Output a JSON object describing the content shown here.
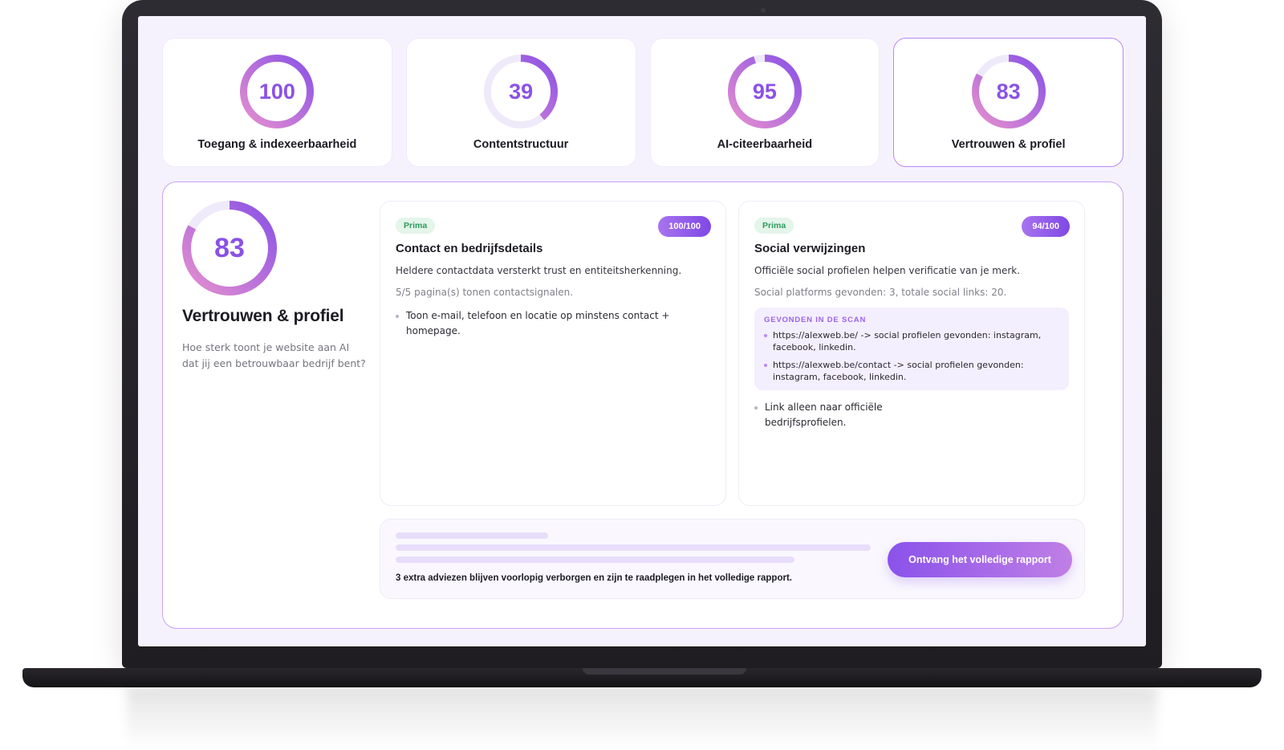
{
  "colors": {
    "accent": "#8a52e6",
    "ring_start": "#e58fcf",
    "ring_end": "#8a52e6",
    "ring_track": "#efeafa",
    "success": "#2c9b5a"
  },
  "score_cards": [
    {
      "score": 100,
      "label": "Toegang & indexeerbaarheid",
      "progress": 1.0,
      "active": false
    },
    {
      "score": 39,
      "label": "Contentstructuur",
      "progress": 0.39,
      "active": false
    },
    {
      "score": 95,
      "label": "AI-citeerbaarheid",
      "progress": 0.95,
      "active": false
    },
    {
      "score": 83,
      "label": "Vertrouwen & profiel",
      "progress": 0.83,
      "active": true
    }
  ],
  "detail": {
    "score": 83,
    "progress": 0.83,
    "title": "Vertrouwen & profiel",
    "description": "Hoe sterk toont je website aan AI dat jij een betrouwbaar bedrijf bent?"
  },
  "items": [
    {
      "status": "Prima",
      "score_label": "100/100",
      "title": "Contact en bedrijfsdetails",
      "text": "Heldere contactdata versterkt trust en entiteitsherkenning.",
      "meta": "5/5 pagina(s) tonen contactsignalen.",
      "tips": [
        "Toon e-mail, telefoon en locatie op minstens contact + homepage."
      ]
    },
    {
      "status": "Prima",
      "score_label": "94/100",
      "title": "Social verwijzingen",
      "text": "Officiële social profielen helpen verificatie van je merk.",
      "meta": "Social platforms gevonden: 3, totale social links: 20.",
      "scan_title": "GEVONDEN IN DE SCAN",
      "scan_items": [
        "https://alexweb.be/ -> social profielen gevonden: instagram, facebook, linkedin.",
        "https://alexweb.be/contact -> social profielen gevonden: instagram, facebook, linkedin."
      ],
      "tips": [
        "Link alleen naar officiële bedrijfsprofielen."
      ]
    }
  ],
  "locked": {
    "text": "3 extra adviezen blijven voorlopig verborgen en zijn te raadplegen in het volledige rapport.",
    "cta_label": "Ontvang het volledige rapport"
  }
}
